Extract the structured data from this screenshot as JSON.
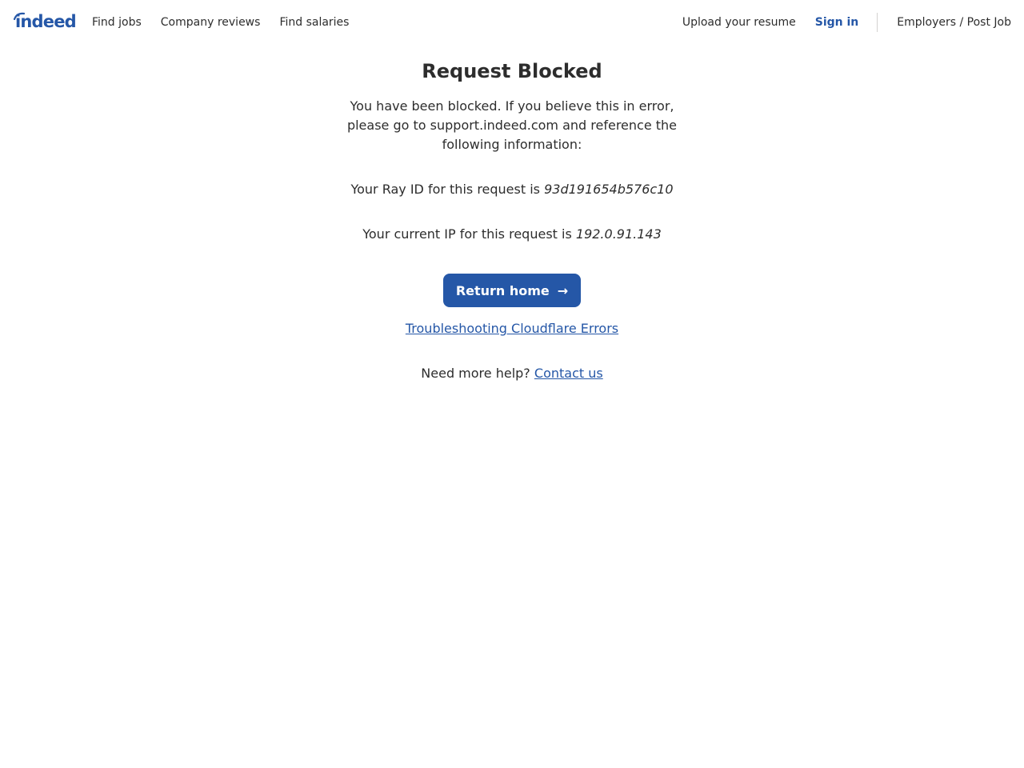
{
  "header": {
    "logo_text": "indeed",
    "nav_left": [
      "Find jobs",
      "Company reviews",
      "Find salaries"
    ],
    "upload_resume": "Upload your resume",
    "sign_in": "Sign in",
    "employers": "Employers / Post Job"
  },
  "main": {
    "title": "Request Blocked",
    "description": "You have been blocked. If you believe this in error, please go to support.indeed.com and reference the following information:",
    "ray_prefix": "Your Ray ID for this request is",
    "ray_id": "93d191654b576c10",
    "ip_prefix": "Your current IP for this request is",
    "ip": "192.0.91.143",
    "return_button": "Return home",
    "return_arrow": "→",
    "troubleshooting_link": "Troubleshooting Cloudflare Errors",
    "help_prefix": "Need more help?",
    "contact_link": "Contact us"
  },
  "colors": {
    "brand": "#2557a7",
    "text": "#2d2d2d"
  }
}
